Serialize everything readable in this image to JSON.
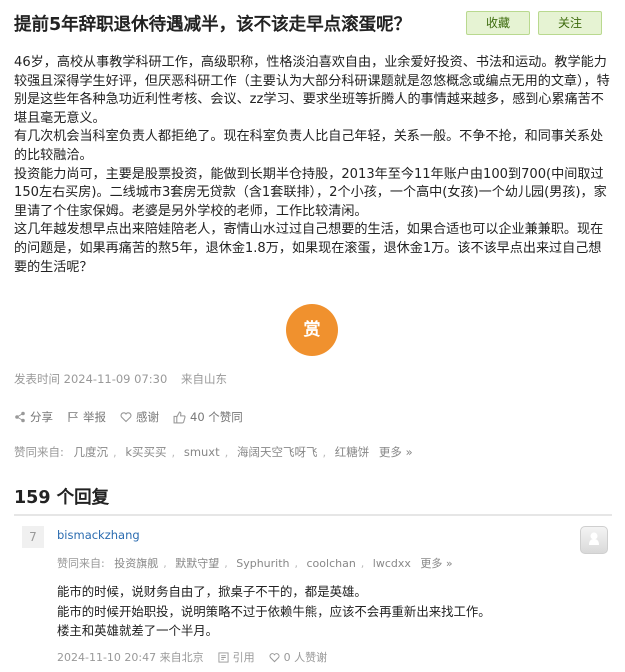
{
  "post": {
    "title": "提前5年辞职退休待遇减半，该不该走早点滚蛋呢？",
    "paragraphs": [
      "46岁，高校从事教学科研工作，高级职称，性格淡泊喜欢自由，业余爱好投资、书法和运动。教学能力较强且深得学生好评，但厌恶科研工作（主要认为大部分科研课题就是忽悠概念或编点无用的文章），特别是这些年各种急功近利性考核、会议、zz学习、要求坐班等折腾人的事情越来越多，感到心累痛苦不堪且毫无意义。",
      "有几次机会当科室负责人都拒绝了。现在科室负责人比自己年轻，关系一般。不争不抢，和同事关系处的比较融洽。",
      "投资能力尚可，主要是股票投资，能做到长期半仓持股，2013年至今11年账户由100到700(中间取过150左右买房)。二线城市3套房无贷款（含1套联排），2个小孩，一个高中(女孩)一个幼儿园(男孩)，家里请了个住家保姆。老婆是另外学校的老师，工作比较清闲。",
      "这几年越发想早点出来陪娃陪老人，寄情山水过过自己想要的生活，如果合适也可以企业兼兼职。现在的问题是，如果再痛苦的熬5年，退休金1.8万，如果现在滚蛋，退休金1万。该不该早点出来过自己想要的生活呢？"
    ],
    "reward_label": "赏",
    "posted": "发表时间 2024-11-09 07:30",
    "location": "来自山东"
  },
  "toolbar": {
    "favorite_label": "收藏",
    "follow_label": "关注"
  },
  "actions": {
    "share": "分享",
    "report": "举报",
    "thank": "感谢",
    "likes": "40 个赞同"
  },
  "likers": {
    "prefix": "赞同来自:",
    "names": [
      "几度沉",
      "k买买买",
      "smuxt",
      "海阔天空飞呀飞",
      "红糖饼"
    ],
    "more": "更多 »"
  },
  "replies_header": "159 个回复",
  "reply": {
    "floor": "7",
    "user": "bismackzhang",
    "likers_prefix": "赞同来自:",
    "likers": [
      "投资旗舰",
      "默默守望",
      "Syphurith",
      "coolchan",
      "lwcdxx"
    ],
    "likers_more": "更多 »",
    "lines": [
      "能市的时候，说财务自由了，掀桌子不干的，都是英雄。",
      "能市的时候开始职投，说明策略不过于依赖牛熊，应该不会再重新出来找工作。",
      "楼主和英雄就差了一个半月。"
    ],
    "time": "2024-11-10 20:47 来自北京",
    "quote": "引用",
    "thanks": "0 人赞谢"
  },
  "colors": {
    "accent_button_bg": "#e6f3d3",
    "accent_button_border": "#b9d98f",
    "reward": "#f0912e",
    "link": "#2b6cb0"
  }
}
